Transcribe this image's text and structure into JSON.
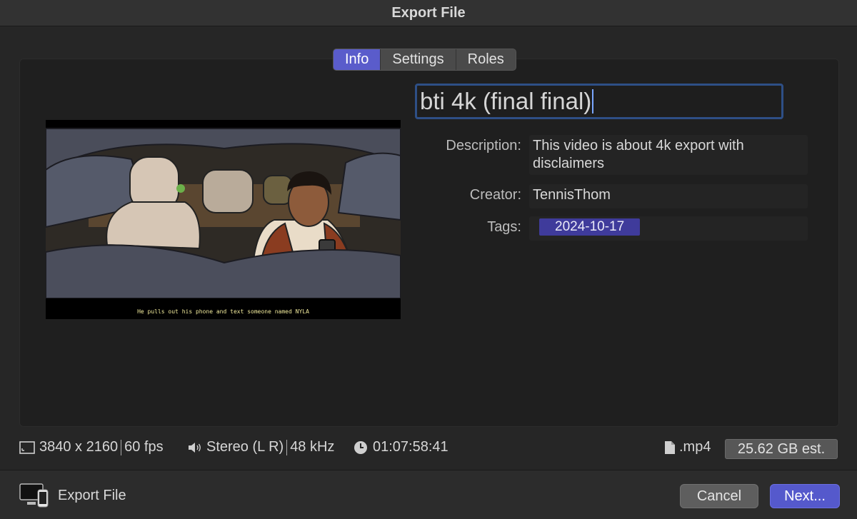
{
  "window": {
    "title": "Export File"
  },
  "tabs": [
    {
      "label": "Info",
      "active": true
    },
    {
      "label": "Settings",
      "active": false
    },
    {
      "label": "Roles",
      "active": false
    }
  ],
  "preview": {
    "subtitle": "He pulls out his phone and text someone named NYLA"
  },
  "info": {
    "title": "bti 4k (final final)",
    "description_label": "Description:",
    "description": "This video is about 4k export with disclaimers",
    "creator_label": "Creator:",
    "creator": "TennisThom",
    "tags_label": "Tags:",
    "tags": [
      "2024-10-17"
    ]
  },
  "status_bar": {
    "resolution": "3840 x 2160",
    "fps": "60 fps",
    "audio": "Stereo (L R)",
    "sample_rate": "48 kHz",
    "duration": "01:07:58:41",
    "format": ".mp4",
    "size_estimate": "25.62 GB est."
  },
  "footer": {
    "destination_label": "Export File",
    "cancel_label": "Cancel",
    "next_label": "Next..."
  },
  "colors": {
    "accent": "#5a5ccb",
    "tag": "#3f3b9b",
    "focus_ring": "#2e4f86"
  }
}
